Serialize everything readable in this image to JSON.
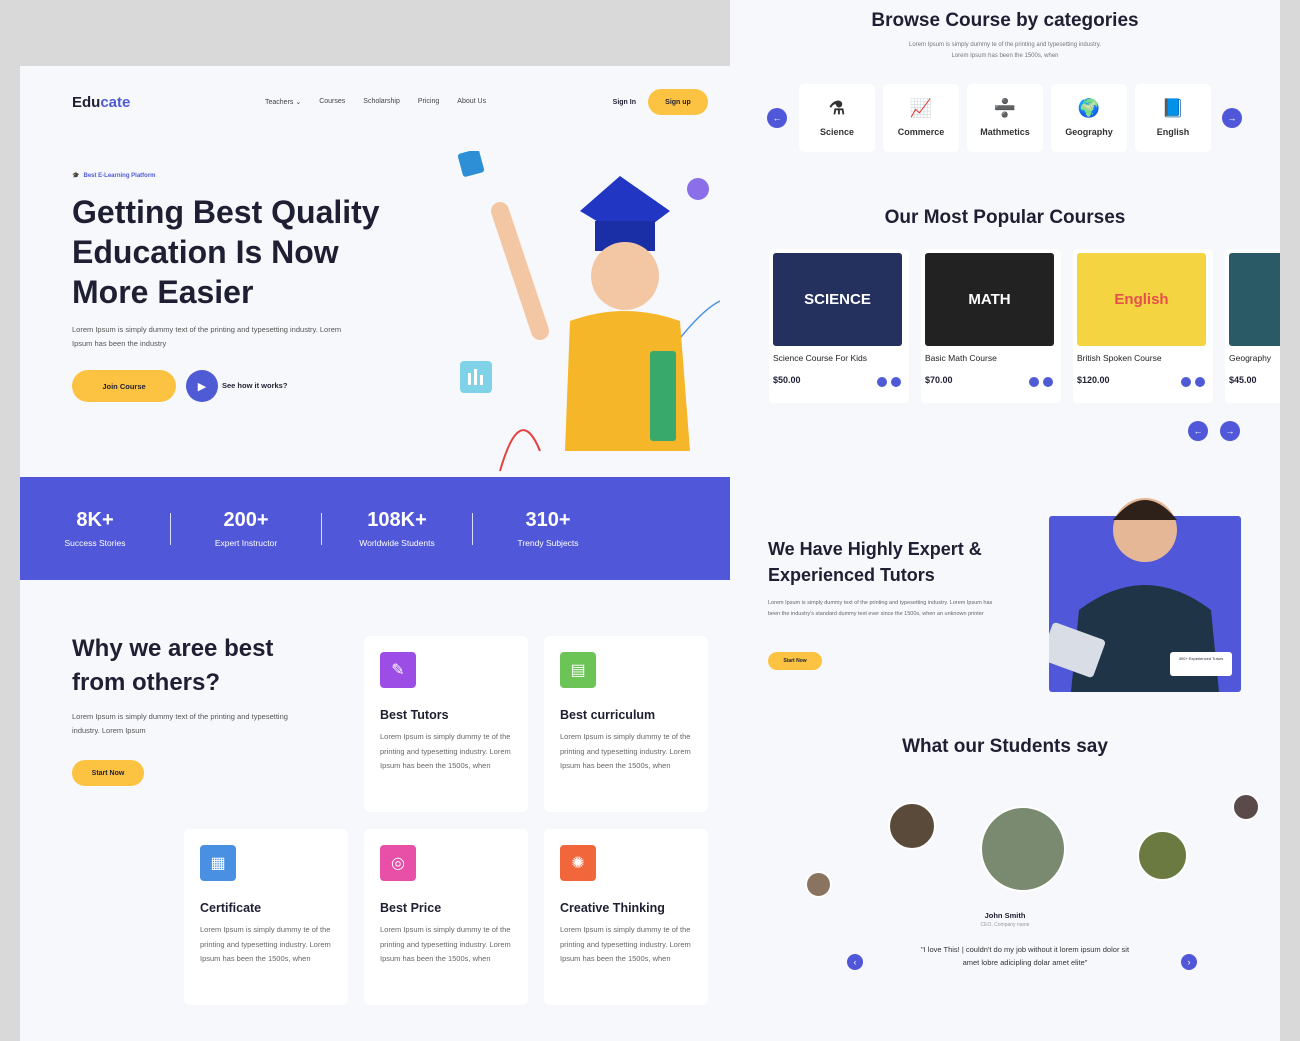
{
  "nav": {
    "logo_main": "Edu",
    "logo_accent": "cate",
    "links": [
      "Teachers ⌄",
      "Courses",
      "Scholarship",
      "Pricing",
      "About Us"
    ],
    "signin": "Sign In",
    "signup": "Sign up"
  },
  "hero": {
    "tag": "Best E-Learning Platform",
    "title": "Getting Best Quality Education Is Now More Easier",
    "description": "Lorem Ipsum is simply dummy text of the printing and typesetting industry. Lorem Ipsum has been the industry",
    "join_label": "Join Course",
    "see_how_label": "See how it works?"
  },
  "stats": [
    {
      "num": "8K+",
      "label": "Success Stories"
    },
    {
      "num": "200+",
      "label": "Expert Instructor"
    },
    {
      "num": "108K+",
      "label": "Worldwide Students"
    },
    {
      "num": "310+",
      "label": "Trendy Subjects"
    }
  ],
  "why": {
    "title": "Why we aree best from others?",
    "description": "Lorem Ipsum is simply dummy text of the printing and typesetting industry. Lorem Ipsum",
    "button": "Start Now",
    "features": [
      {
        "title": "Best Tutors",
        "desc": "Lorem Ipsum is simply dummy te of the printing and typesetting industry. Lorem Ipsum has been the 1500s, when",
        "color": "#9c4de6",
        "icon": "✎"
      },
      {
        "title": "Best curriculum",
        "desc": "Lorem Ipsum is simply dummy te of the printing and typesetting industry. Lorem Ipsum has been the 1500s, when",
        "color": "#6bc455",
        "icon": "▤"
      },
      {
        "title": "Certificate",
        "desc": "Lorem Ipsum is simply dummy te of the printing and typesetting industry. Lorem Ipsum has been the 1500s, when",
        "color": "#4a90e2",
        "icon": "▦"
      },
      {
        "title": "Best Price",
        "desc": "Lorem Ipsum is simply dummy te of the printing and typesetting industry. Lorem Ipsum has been the 1500s, when",
        "color": "#e84fa6",
        "icon": "◎"
      },
      {
        "title": "Creative Thinking",
        "desc": "Lorem Ipsum is simply dummy te of the printing and typesetting industry. Lorem Ipsum has been the 1500s, when",
        "color": "#f2663b",
        "icon": "✺"
      }
    ]
  },
  "categories": {
    "title": "Browse Course by categories",
    "subtitle_1": "Lorem Ipsum is simply dummy te of the printing and typesetting industry.",
    "subtitle_2": "Lorem Ipsum has been the 1500s, when",
    "items": [
      {
        "label": "Science",
        "icon": "⚗"
      },
      {
        "label": "Commerce",
        "icon": "📈"
      },
      {
        "label": "Mathmetics",
        "icon": "➗"
      },
      {
        "label": "Geography",
        "icon": "🌍"
      },
      {
        "label": "English",
        "icon": "📘"
      }
    ]
  },
  "popular": {
    "title": "Our Most Popular Courses",
    "courses": [
      {
        "thumb": "SCIENCE",
        "title": "Science Course For Kids",
        "price": "$50.00",
        "color": "#24305e"
      },
      {
        "thumb": "MATH",
        "title": "Basic Math Course",
        "price": "$70.00",
        "color": "#222"
      },
      {
        "thumb": "English",
        "title": "British Spoken Course",
        "price": "$120.00",
        "color": "#f5d442"
      },
      {
        "thumb": "",
        "title": "Geography",
        "price": "$45.00",
        "color": "#2a5a66"
      }
    ]
  },
  "tutors": {
    "title": "We Have Highly Expert & Experienced Tutors",
    "description": "Lorem Ipsum is simply dummy text of the printing and typesetting industry. Lorem Ipsum has been the industry's standard dummy text ever since the 1500s, when an unknown printer",
    "button": "Start Now",
    "badge": "300+ Experienced Tutors"
  },
  "testimonials": {
    "title": "What our Students say",
    "name": "John Smith",
    "role": "CEO, Company name",
    "quote": "\"I love This! | couldn't do my job without it lorem ipsum dolor sit amet lobre adicipling dolar amet elite\""
  }
}
